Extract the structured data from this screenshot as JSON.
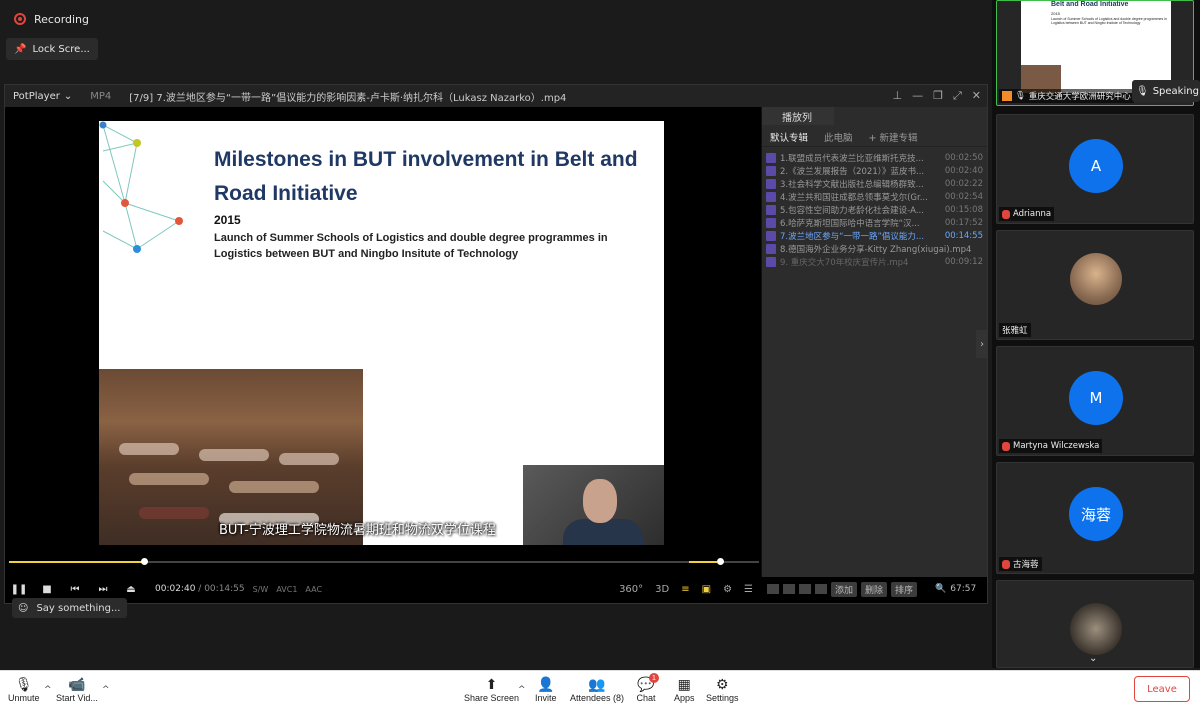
{
  "recording": {
    "label": "Recording"
  },
  "lock_screen": {
    "label": "Lock Scre..."
  },
  "player": {
    "brand": "PotPlayer",
    "format": "MP4",
    "file_title": "[7/9] 7.波兰地区参与“一带一路”倡议能力的影响因素-卢卡斯·纳扎尔科（Lukasz Nazarko）.mp4",
    "time_current": "00:02:40",
    "time_total": "00:14:55",
    "tags": [
      "S/W",
      "AVC1",
      "AAC"
    ],
    "progress": 0.18,
    "volume": 0.45
  },
  "slide": {
    "title": "Milestones in BUT involvement in Belt and Road Initiative",
    "year": "2015",
    "text": "Launch of Summer Schools of Logistics and double degree programmes in Logistics between BUT and Ningbo Insitute of Technology",
    "subtitle": "BUT-宁波理工学院物流暑期班和物流双学位课程"
  },
  "playlist": {
    "header": "播放列表",
    "tabs": [
      "默认专辑",
      "此电脑",
      "+ 新建专辑"
    ],
    "items": [
      {
        "name": "1.联盟成员代表波兰比亚维斯托克技...",
        "dur": "00:02:50",
        "state": "normal"
      },
      {
        "name": "2.《波兰发展报告（2021）》蓝皮书...",
        "dur": "00:02:40",
        "state": "normal"
      },
      {
        "name": "3.社会科学文献出版社总编辑杨群致...",
        "dur": "00:02:22",
        "state": "normal"
      },
      {
        "name": "4.波兰共和国驻成都总领事莫戈尔(Gr...",
        "dur": "00:02:54",
        "state": "normal"
      },
      {
        "name": "5.包容性空间助力老龄化社会建设-A...",
        "dur": "00:15:08",
        "state": "normal"
      },
      {
        "name": "6.哈萨克斯坦国际哈中语言学院“汉...",
        "dur": "00:17:52",
        "state": "normal"
      },
      {
        "name": "7.波兰地区参与“一带一路”倡议能力...",
        "dur": "00:14:55",
        "state": "cur"
      },
      {
        "name": "8.德国海外企业务分享-Kitty Zhang(xiugai).mp4",
        "dur": "",
        "state": "normal"
      },
      {
        "name": "9. 重庆交大70年校庆宣传片.mp4",
        "dur": "00:09:12",
        "state": "dim"
      }
    ],
    "buttons": [
      "添加",
      "删除",
      "排序"
    ],
    "total": "67:57"
  },
  "say_something": {
    "label": "Say something..."
  },
  "gallery": {
    "top_name": "重庆交通大学欧洲研究中心",
    "top_slide_title": "Belt and Road Initiative",
    "top_slide_year": "2015",
    "top_slide_text": "Launch of Summer Schools of Logistics and double degree programmes in Logistics between BUT and Ningbo Insitute of Technology",
    "speaking": "Speaking",
    "participants": [
      {
        "initial": "A",
        "name": "Adrianna"
      },
      {
        "initial": "",
        "name": "张雅虹"
      },
      {
        "initial": "M",
        "name": "Martyna Wilczewska"
      },
      {
        "initial": "海蓉",
        "name": "古海蓉"
      }
    ]
  },
  "toolbar": {
    "unmute": "Unmute",
    "start_video": "Start Vid...",
    "share_screen": "Share Screen",
    "invite": "Invite",
    "attendees": "Attendees (8)",
    "chat": "Chat",
    "chat_badge": "1",
    "apps": "Apps",
    "settings": "Settings",
    "leave": "Leave"
  },
  "colors": {
    "zoom_blue": "#0e72ed",
    "leave_red": "#e0463d",
    "slide_title": "#1f3864",
    "accent_yellow": "#f2d23a"
  }
}
